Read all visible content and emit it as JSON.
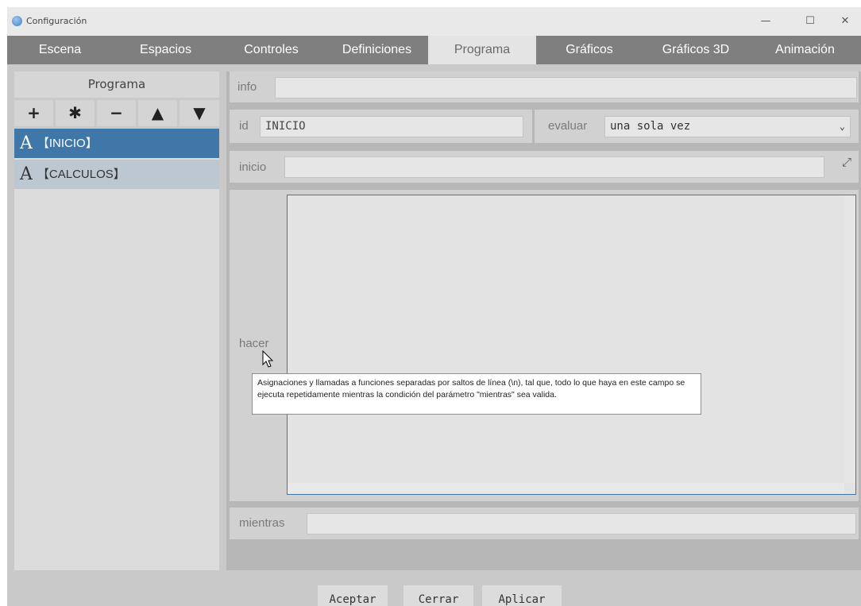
{
  "window": {
    "title": "Configuración",
    "controls": {
      "minimize": "—",
      "maximize": "☐",
      "close": "✕"
    }
  },
  "tabs": [
    {
      "label": "Escena",
      "active": false
    },
    {
      "label": "Espacios",
      "active": false
    },
    {
      "label": "Controles",
      "active": false
    },
    {
      "label": "Definiciones",
      "active": false
    },
    {
      "label": "Programa",
      "active": true
    },
    {
      "label": "Gráficos",
      "active": false
    },
    {
      "label": "Gráficos 3D",
      "active": false
    },
    {
      "label": "Animación",
      "active": false
    }
  ],
  "left_panel": {
    "header": "Programa",
    "tools": [
      {
        "symbol": "+",
        "icon": "plus-icon"
      },
      {
        "symbol": "✱",
        "icon": "asterisk-icon"
      },
      {
        "symbol": "−",
        "icon": "minus-icon"
      },
      {
        "symbol": "▲",
        "icon": "up-arrow-icon"
      },
      {
        "symbol": "▼",
        "icon": "down-arrow-icon"
      }
    ],
    "items": [
      {
        "glyph": "A",
        "label": "【INICIO】",
        "selected": true
      },
      {
        "glyph": "A",
        "label": "【CALCULOS】",
        "selected": false
      }
    ]
  },
  "form": {
    "info": {
      "label": "info",
      "value": ""
    },
    "id": {
      "label": "id",
      "value": "INICIO"
    },
    "evaluar": {
      "label": "evaluar",
      "value": "una sola vez"
    },
    "inicio": {
      "label": "inicio",
      "value": ""
    },
    "hacer": {
      "label": "hacer",
      "value": ""
    },
    "mientras": {
      "label": "mientras",
      "value": ""
    }
  },
  "tooltip": {
    "text": "Asignaciones y llamadas a funciones separadas por saltos de línea (\\n), tal que, todo lo que haya en este campo se ejecuta repetidamente mientras la condición del parámetro \"mientras\" sea valida."
  },
  "buttons": {
    "accept": "Aceptar",
    "close": "Cerrar",
    "apply": "Aplicar"
  },
  "colors": {
    "selected": "#3f77a8",
    "tab_bar": "#7f7f7f",
    "active_tab": "#e4e4e4"
  }
}
